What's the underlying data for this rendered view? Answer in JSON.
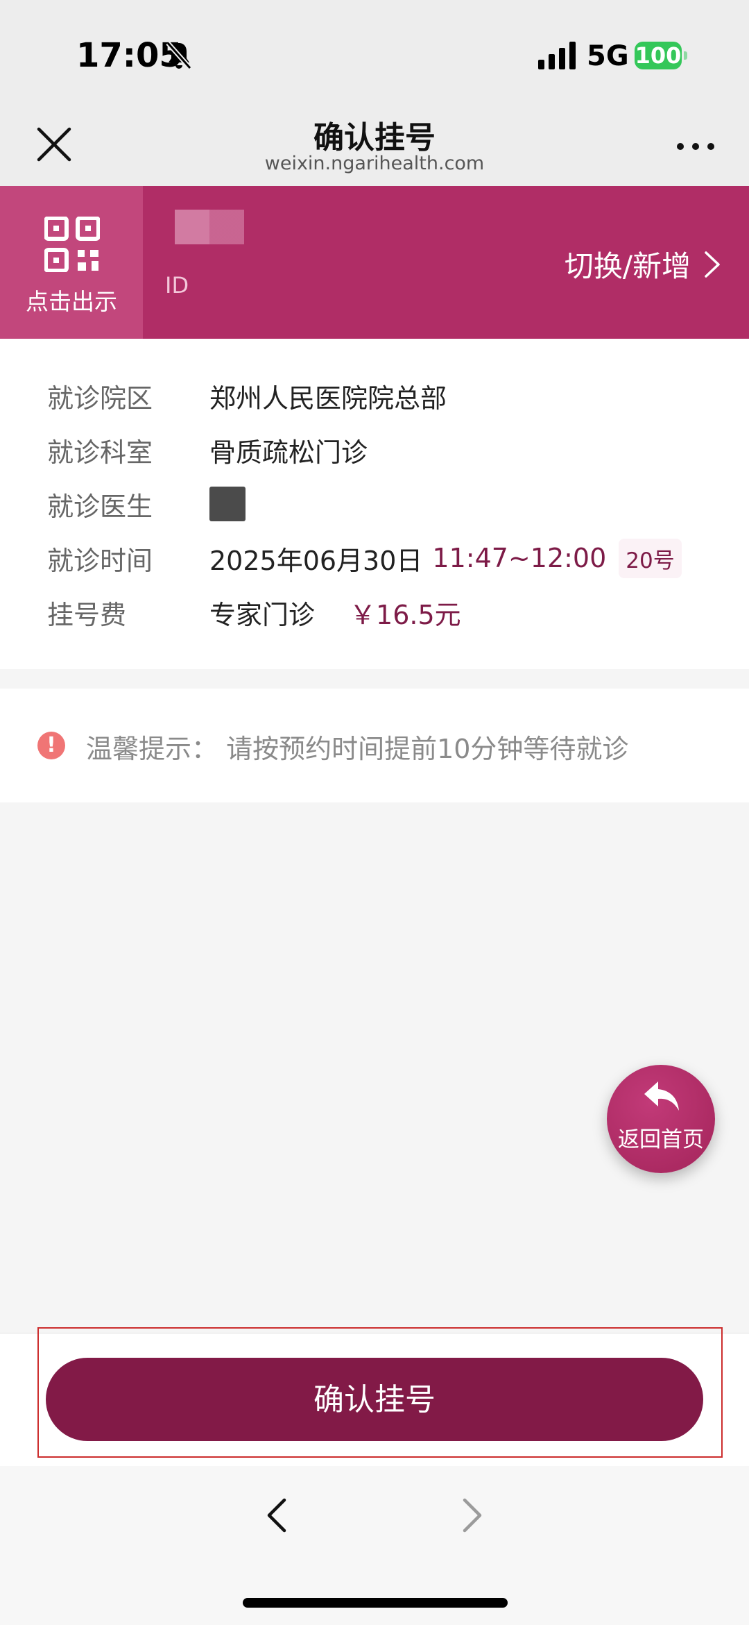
{
  "status_bar": {
    "time": "17:05",
    "network": "5G",
    "battery": "100"
  },
  "nav": {
    "title": "确认挂号",
    "url": "weixin.ngarihealth.com"
  },
  "patient": {
    "qr_label": "点击出示",
    "id_label": "ID",
    "switch_label": "切换/新增"
  },
  "info": {
    "campus": {
      "label": "就诊院区",
      "value": "郑州人民医院院总部"
    },
    "department": {
      "label": "就诊科室",
      "value": "骨质疏松门诊"
    },
    "doctor": {
      "label": "就诊医生"
    },
    "time": {
      "label": "就诊时间",
      "date": "2025年06月30日",
      "range": "11:47~12:00",
      "queue": "20号"
    },
    "fee": {
      "label": "挂号费",
      "type": "专家门诊",
      "amount": "￥16.5元"
    }
  },
  "tip": {
    "text": "温馨提示：  请按预约时间提前10分钟等待就诊"
  },
  "home_fab": {
    "label": "返回首页"
  },
  "confirm_button": {
    "label": "确认挂号"
  },
  "colors": {
    "brand": "#b02d66",
    "accent": "#821a47",
    "highlight": "#cc2d2d"
  }
}
